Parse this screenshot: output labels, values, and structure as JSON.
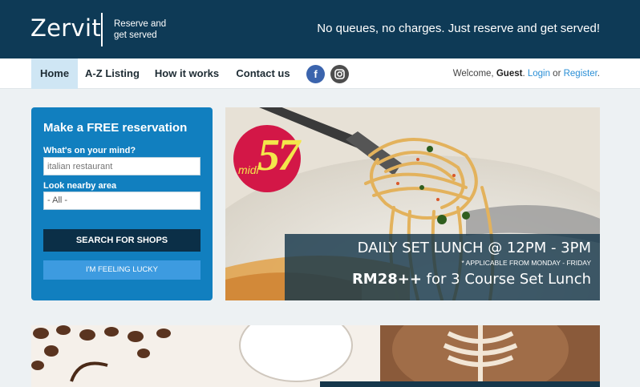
{
  "header": {
    "logo": "Zervit",
    "tagline_small": "Reserve and get served",
    "tagline_big": "No queues, no charges. Just reserve and get served!"
  },
  "nav": {
    "items": [
      "Home",
      "A-Z Listing",
      "How it works",
      "Contact us"
    ],
    "active": "Home",
    "social": [
      "facebook-icon",
      "instagram-icon"
    ],
    "welcome_prefix": "Welcome,",
    "welcome_user": "Guest",
    "login": "Login",
    "or": "or",
    "register": "Register"
  },
  "reservation": {
    "title": "Make a FREE reservation",
    "mind_label": "What's on your mind?",
    "mind_placeholder": "italian restaurant",
    "area_label": "Look nearby area",
    "area_value": "- All -",
    "search_button": "SEARCH FOR SHOPS",
    "lucky_button": "I'M FEELING LUCKY"
  },
  "banner": {
    "badge_number": "57",
    "badge_text": "midi",
    "line1": "DAILY SET LUNCH @ 12PM - 3PM",
    "line2": "* APPLICABLE FROM MONDAY - FRIDAY",
    "price": "RM28++",
    "price_suffix": "for 3 Course Set Lunch"
  },
  "colors": {
    "header_bg": "#0e3a56",
    "panel_bg": "#117fbf",
    "accent_link": "#2a8fd6",
    "badge_red": "#d31747",
    "badge_yellow": "#f3e64b"
  }
}
